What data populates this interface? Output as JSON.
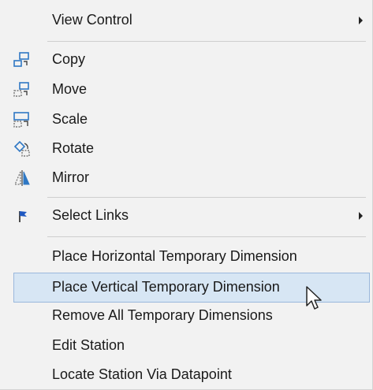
{
  "menu": {
    "view_control": "View Control",
    "copy": "Copy",
    "move": "Move",
    "scale": "Scale",
    "rotate": "Rotate",
    "mirror": "Mirror",
    "select_links": "Select Links",
    "place_horizontal": "Place Horizontal Temporary Dimension",
    "place_vertical": "Place Vertical Temporary Dimension",
    "remove_all": "Remove All Temporary Dimensions",
    "edit_station": "Edit Station",
    "locate_station": "Locate Station Via Datapoint"
  },
  "icons": {
    "copy": "copy-icon",
    "move": "move-icon",
    "scale": "scale-icon",
    "rotate": "rotate-icon",
    "mirror": "mirror-icon",
    "select_links": "flag-icon"
  },
  "highlighted_item": "place_vertical",
  "colors": {
    "menu_bg": "#f2f2f2",
    "highlight_bg": "#d7e6f4",
    "highlight_border": "#9ab8dc",
    "icon_blue": "#2f78c4"
  }
}
